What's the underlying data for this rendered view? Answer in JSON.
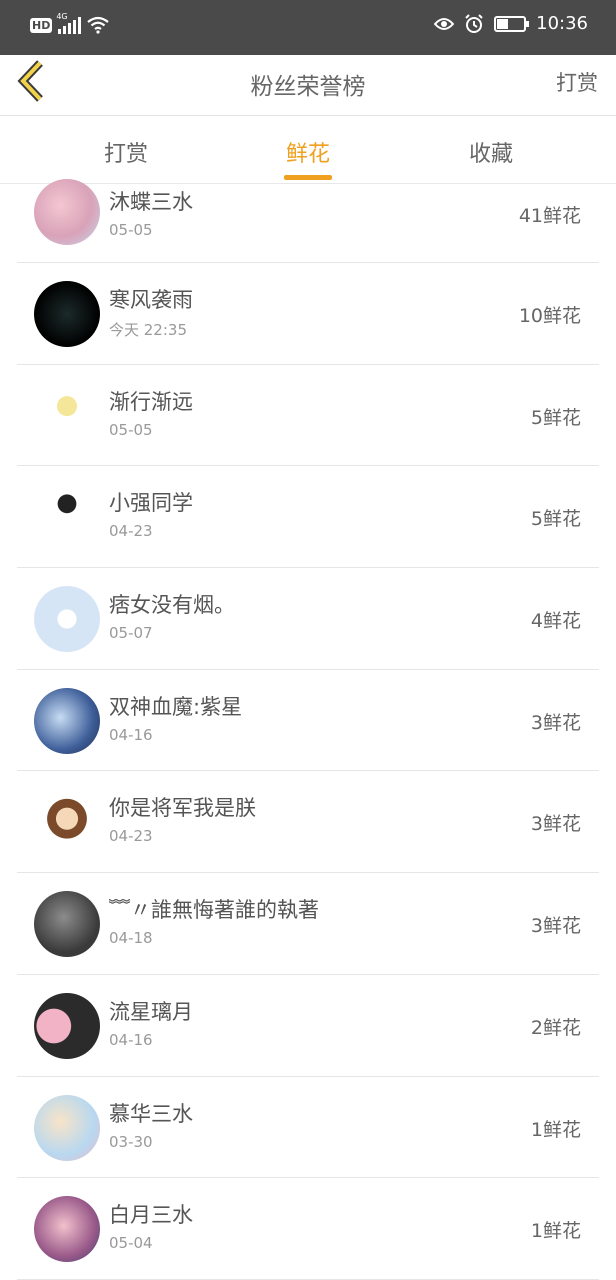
{
  "status_bar": {
    "hd": "HD",
    "network": "4G",
    "time": "10:36",
    "battery_percent": 40
  },
  "header": {
    "title": "粉丝荣誉榜",
    "action_label": "打赏"
  },
  "tabs": [
    {
      "label": "打赏",
      "active": false
    },
    {
      "label": "鲜花",
      "active": true
    },
    {
      "label": "收藏",
      "active": false
    }
  ],
  "accent_color": "#f0a020",
  "fans": [
    {
      "name": "沐蝶三水",
      "date": "05-05",
      "count": "41鲜花"
    },
    {
      "name": "寒风袭雨",
      "date": "今天 22:35",
      "count": "10鲜花"
    },
    {
      "name": "渐行渐远",
      "date": "05-05",
      "count": "5鲜花"
    },
    {
      "name": "小强同学",
      "date": "04-23",
      "count": "5鲜花"
    },
    {
      "name": "痞女没有烟。",
      "date": "05-07",
      "count": "4鲜花"
    },
    {
      "name": "双神血魔:紫星",
      "date": "04-16",
      "count": "3鲜花"
    },
    {
      "name": "你是将军我是朕",
      "date": "04-23",
      "count": "3鲜花"
    },
    {
      "name": "﹌〃誰無悔著誰的執著",
      "date": "04-18",
      "count": "3鲜花"
    },
    {
      "name": "流星璃月",
      "date": "04-16",
      "count": "2鲜花"
    },
    {
      "name": "慕华三水",
      "date": "03-30",
      "count": "1鲜花"
    },
    {
      "name": "白月三水",
      "date": "05-04",
      "count": "1鲜花"
    }
  ]
}
